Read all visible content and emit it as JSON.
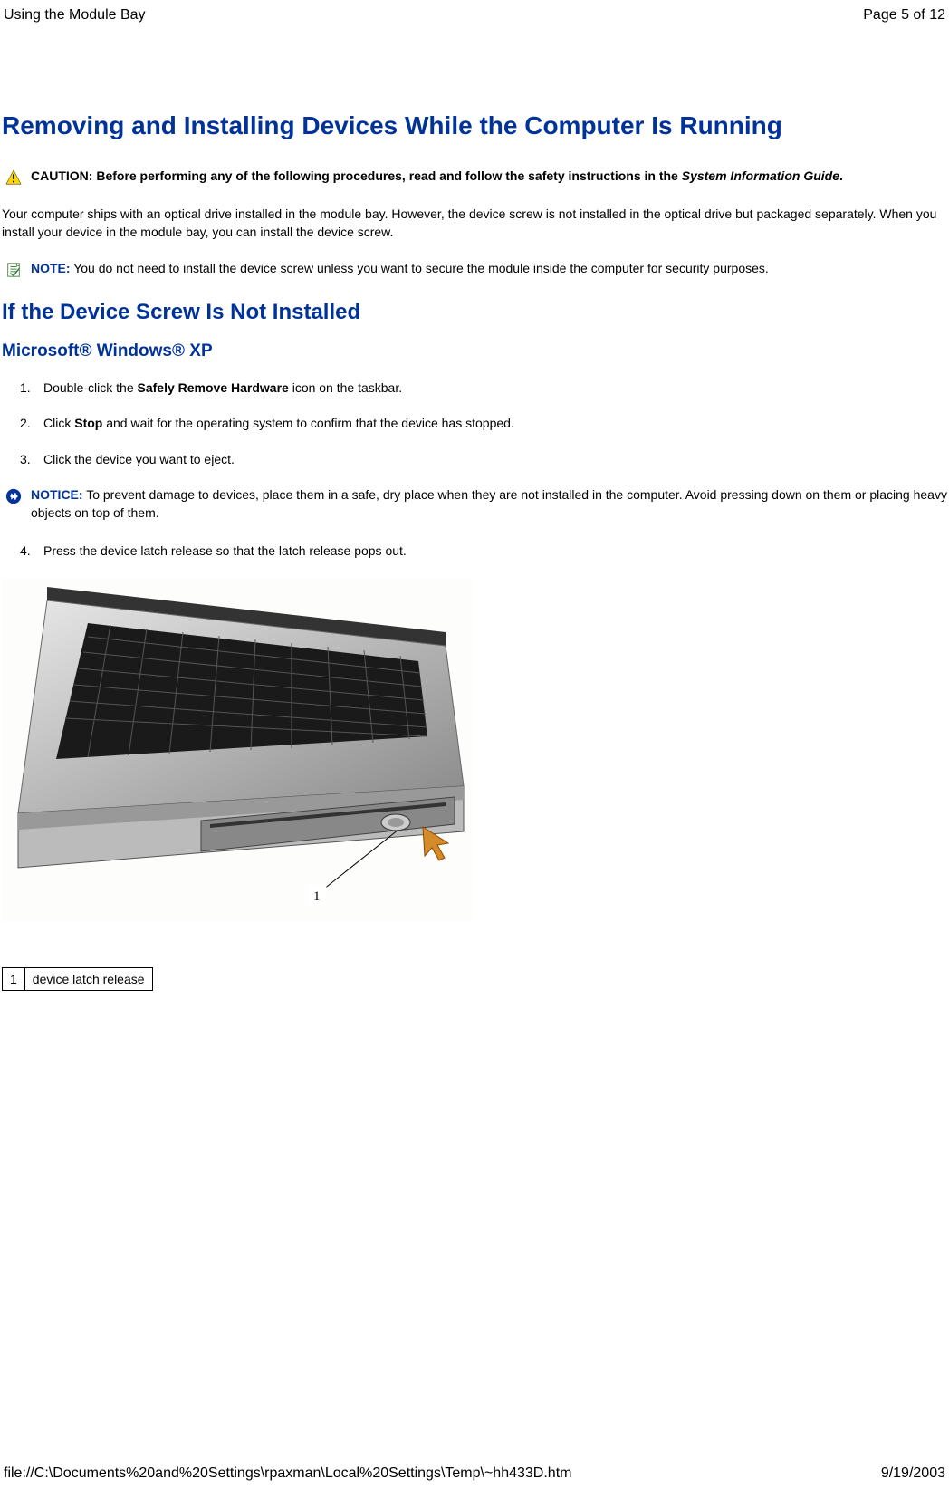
{
  "header": {
    "left": "Using the Module Bay",
    "right": "Page 5 of 12"
  },
  "h1": "Removing and Installing Devices While the Computer Is Running",
  "caution": {
    "label": "CAUTION:",
    "text_before": " Before performing any of the following procedures, read and follow the safety instructions in the ",
    "italic": "System Information Guide",
    "text_after": "."
  },
  "para1": "Your computer ships with an optical drive installed in the module bay. However, the device screw is not installed in the optical drive but packaged separately. When you install your device in the module bay, you can install the device screw.",
  "note": {
    "label": "NOTE:",
    "text": " You do not need to install the device screw unless you want to secure the module inside the computer for security purposes."
  },
  "h2": "If the Device Screw Is Not Installed",
  "h3": "Microsoft® Windows® XP",
  "steps": {
    "s1_a": "Double-click the ",
    "s1_b": "Safely Remove Hardware",
    "s1_c": " icon on the taskbar.",
    "s2_a": "Click ",
    "s2_b": "Stop",
    "s2_c": " and wait for the operating system to confirm that the device has stopped.",
    "s3": "Click the device you want to eject.",
    "s4": "Press the device latch release so that the latch release pops out."
  },
  "notice": {
    "label": "NOTICE:",
    "text": " To prevent damage to devices, place them in a safe, dry place when they are not installed in the computer. Avoid pressing down on them or placing heavy objects on top of them."
  },
  "legend": {
    "num": "1",
    "text": "device latch release"
  },
  "footer": {
    "left": "file://C:\\Documents%20and%20Settings\\rpaxman\\Local%20Settings\\Temp\\~hh433D.htm",
    "right": "9/19/2003"
  },
  "figure_label": "1"
}
